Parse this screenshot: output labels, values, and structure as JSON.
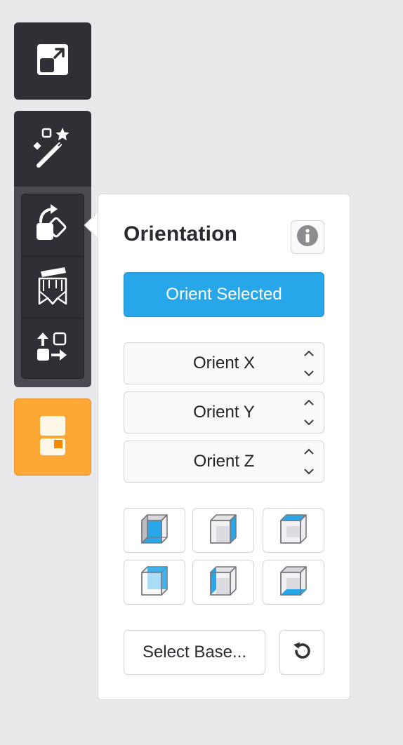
{
  "toolbar": {
    "tools": [
      {
        "icon": "scale-icon",
        "state": "default"
      },
      {
        "icon": "magic-wand-icon",
        "state": "default"
      },
      {
        "icon": "rotate-icon",
        "state": "active"
      },
      {
        "icon": "supports-icon",
        "state": "default"
      },
      {
        "icon": "arrange-icon",
        "state": "default"
      },
      {
        "icon": "printer-icon",
        "state": "highlight"
      }
    ],
    "highlight_color": "#fda734"
  },
  "panel": {
    "title": "Orientation",
    "info_icon": "info-icon",
    "orient_selected_label": "Orient Selected",
    "accent_color": "#27a7ea",
    "steppers": [
      {
        "label": "Orient X"
      },
      {
        "label": "Orient Y"
      },
      {
        "label": "Orient Z"
      }
    ],
    "face_buttons": [
      {
        "icon": "cube-face-front-icon"
      },
      {
        "icon": "cube-face-right-icon"
      },
      {
        "icon": "cube-face-top-icon"
      },
      {
        "icon": "cube-face-back-icon"
      },
      {
        "icon": "cube-face-left-icon"
      },
      {
        "icon": "cube-face-bottom-icon"
      }
    ],
    "select_base_label": "Select Base...",
    "reset_icon": "reset-icon"
  }
}
